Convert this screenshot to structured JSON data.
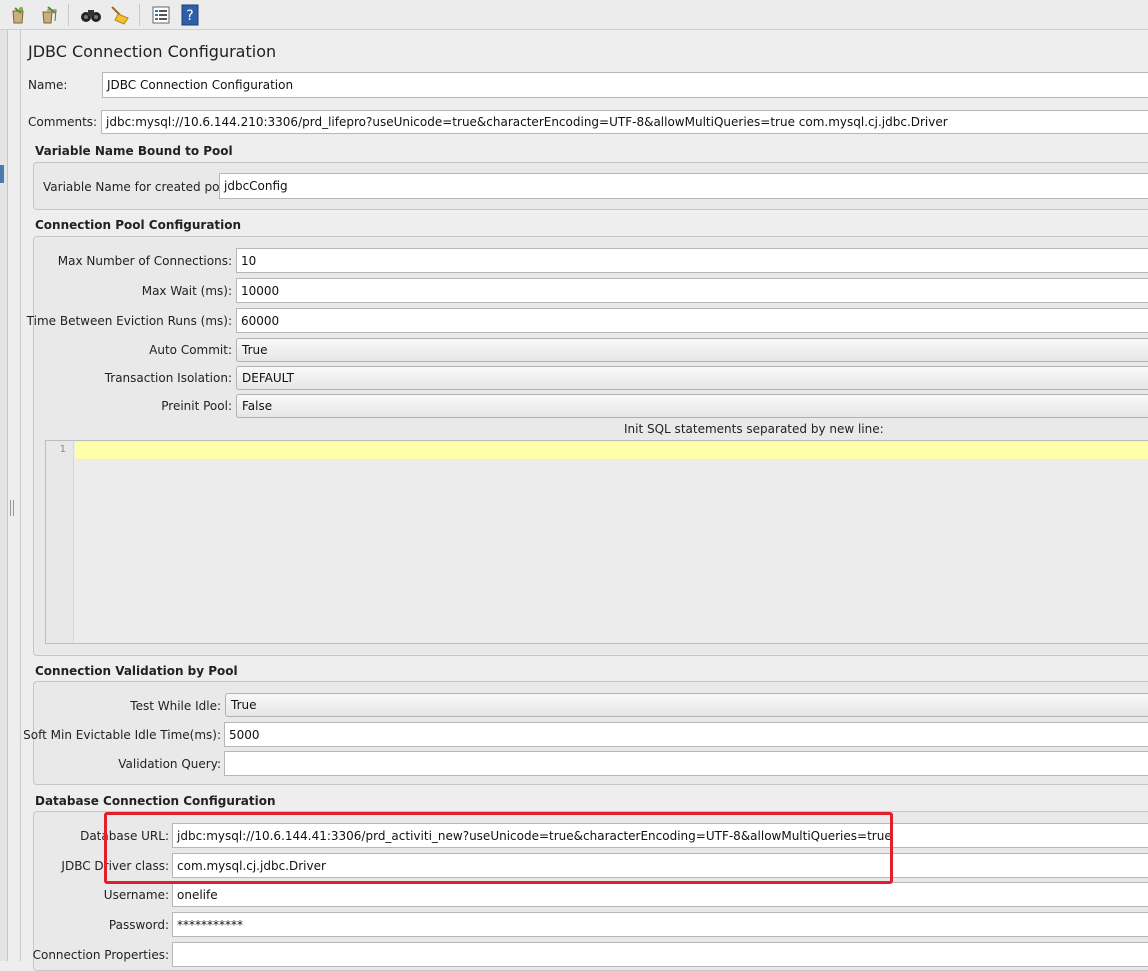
{
  "toolbar": {
    "icons": [
      "clear-icon",
      "clear-all-icon",
      "search-binoculars-icon",
      "reset-search-broom-icon",
      "function-helper-list-icon",
      "help-icon"
    ]
  },
  "header": {
    "title": "JDBC Connection Configuration",
    "name_label": "Name:",
    "name_value": "JDBC Connection Configuration",
    "comments_label": "Comments:",
    "comments_value": "jdbc:mysql://10.6.144.210:3306/prd_lifepro?useUnicode=true&characterEncoding=UTF-8&allowMultiQueries=true  com.mysql.cj.jdbc.Driver"
  },
  "variable_section": {
    "title": "Variable Name Bound to Pool",
    "pool_var_label": "Variable Name for created pool:",
    "pool_var_value": "jdbcConfig"
  },
  "pool_section": {
    "title": "Connection Pool Configuration",
    "max_connections_label": "Max Number of Connections:",
    "max_connections_value": "10",
    "max_wait_label": "Max Wait (ms):",
    "max_wait_value": "10000",
    "eviction_label": "Time Between Eviction Runs (ms):",
    "eviction_value": "60000",
    "auto_commit_label": "Auto Commit:",
    "auto_commit_value": "True",
    "isolation_label": "Transaction Isolation:",
    "isolation_value": "DEFAULT",
    "preinit_label": "Preinit Pool:",
    "preinit_value": "False",
    "init_sql_label": "Init SQL statements separated by new line:",
    "init_sql_line_number": "1"
  },
  "validation_section": {
    "title": "Connection Validation by Pool",
    "test_idle_label": "Test While Idle:",
    "test_idle_value": "True",
    "soft_min_label": "Soft Min Evictable Idle Time(ms):",
    "soft_min_value": "5000",
    "validation_query_label": "Validation Query:",
    "validation_query_value": ""
  },
  "db_section": {
    "title": "Database Connection Configuration",
    "url_label": "Database URL:",
    "url_value": "jdbc:mysql://10.6.144.41:3306/prd_activiti_new?useUnicode=true&characterEncoding=UTF-8&allowMultiQueries=true",
    "driver_label": "JDBC Driver class:",
    "driver_value": "com.mysql.cj.jdbc.Driver",
    "username_label": "Username:",
    "username_value": "onelife",
    "password_label": "Password:",
    "password_value": "***********",
    "props_label": "Connection Properties:",
    "props_value": ""
  },
  "colors": {
    "annotation_box": "#e0202c",
    "sql_current_line": "#ffffaa"
  }
}
